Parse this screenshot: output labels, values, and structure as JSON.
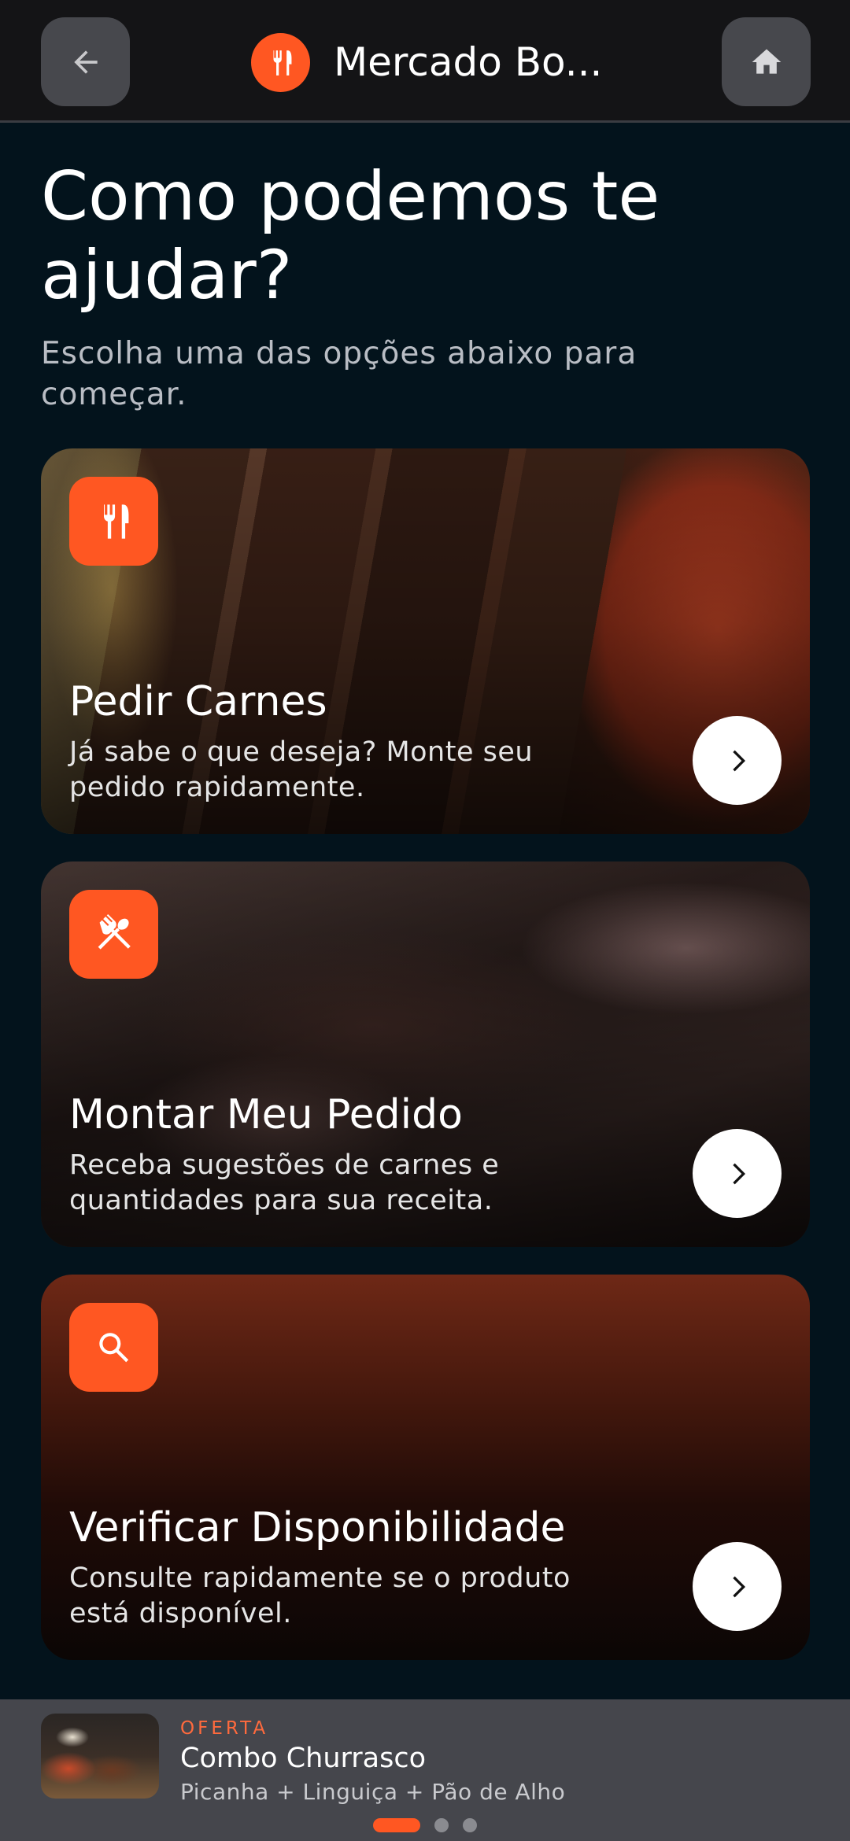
{
  "header": {
    "store_name": "Mercado Bo...",
    "back_icon": "arrow-left-icon",
    "home_icon": "home-icon",
    "brand_icon": "utensils-icon"
  },
  "hero": {
    "title": "Como podemos te ajudar?",
    "subtitle": "Escolha uma das opções abaixo para começar."
  },
  "cards": [
    {
      "title": "Pedir Carnes",
      "description": "Já sabe o que deseja? Monte seu pedido rapidamente.",
      "icon": "utensils-icon"
    },
    {
      "title": "Montar Meu Pedido",
      "description": "Receba sugestões de carnes e quantidades para sua receita.",
      "icon": "fork-spoon-crossed-icon"
    },
    {
      "title": "Verificar Disponibilidade",
      "description": "Consulte rapidamente se o produto está disponível.",
      "icon": "search-icon"
    }
  ],
  "offer": {
    "tag": "OFERTA",
    "title": "Combo Churrasco",
    "subtitle": "Picanha + Linguiça + Pão de Alho",
    "carousel_pages": 3,
    "active_page": 1
  },
  "colors": {
    "accent": "#ff5722",
    "background": "#03131c",
    "header": "#141416",
    "offer_bar": "#45464c"
  }
}
